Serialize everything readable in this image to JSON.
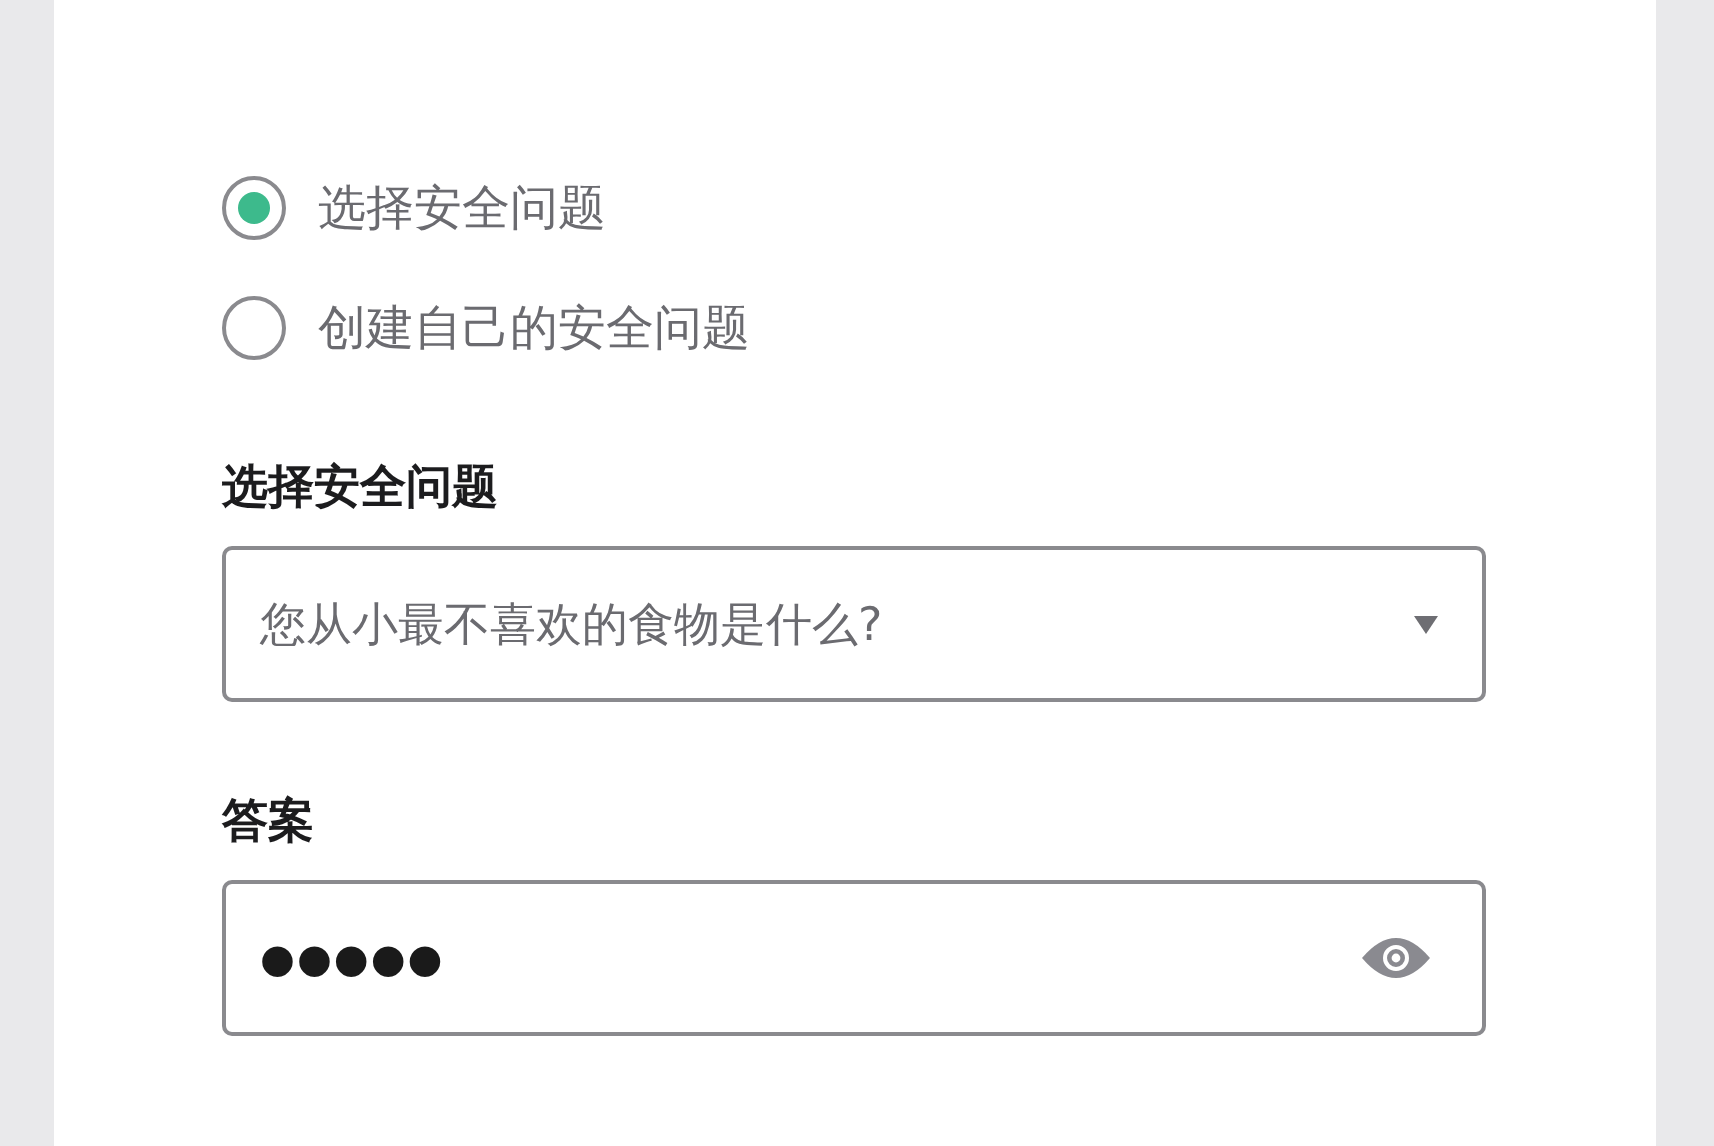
{
  "question_type": [
    {
      "label": "选择安全问题",
      "selected": true
    },
    {
      "label": "创建自己的安全问题",
      "selected": false
    }
  ],
  "question": {
    "label": "选择安全问题",
    "value": "您从小最不喜欢的食物是什么?"
  },
  "answer": {
    "label": "答案",
    "value": "●●●●●"
  }
}
